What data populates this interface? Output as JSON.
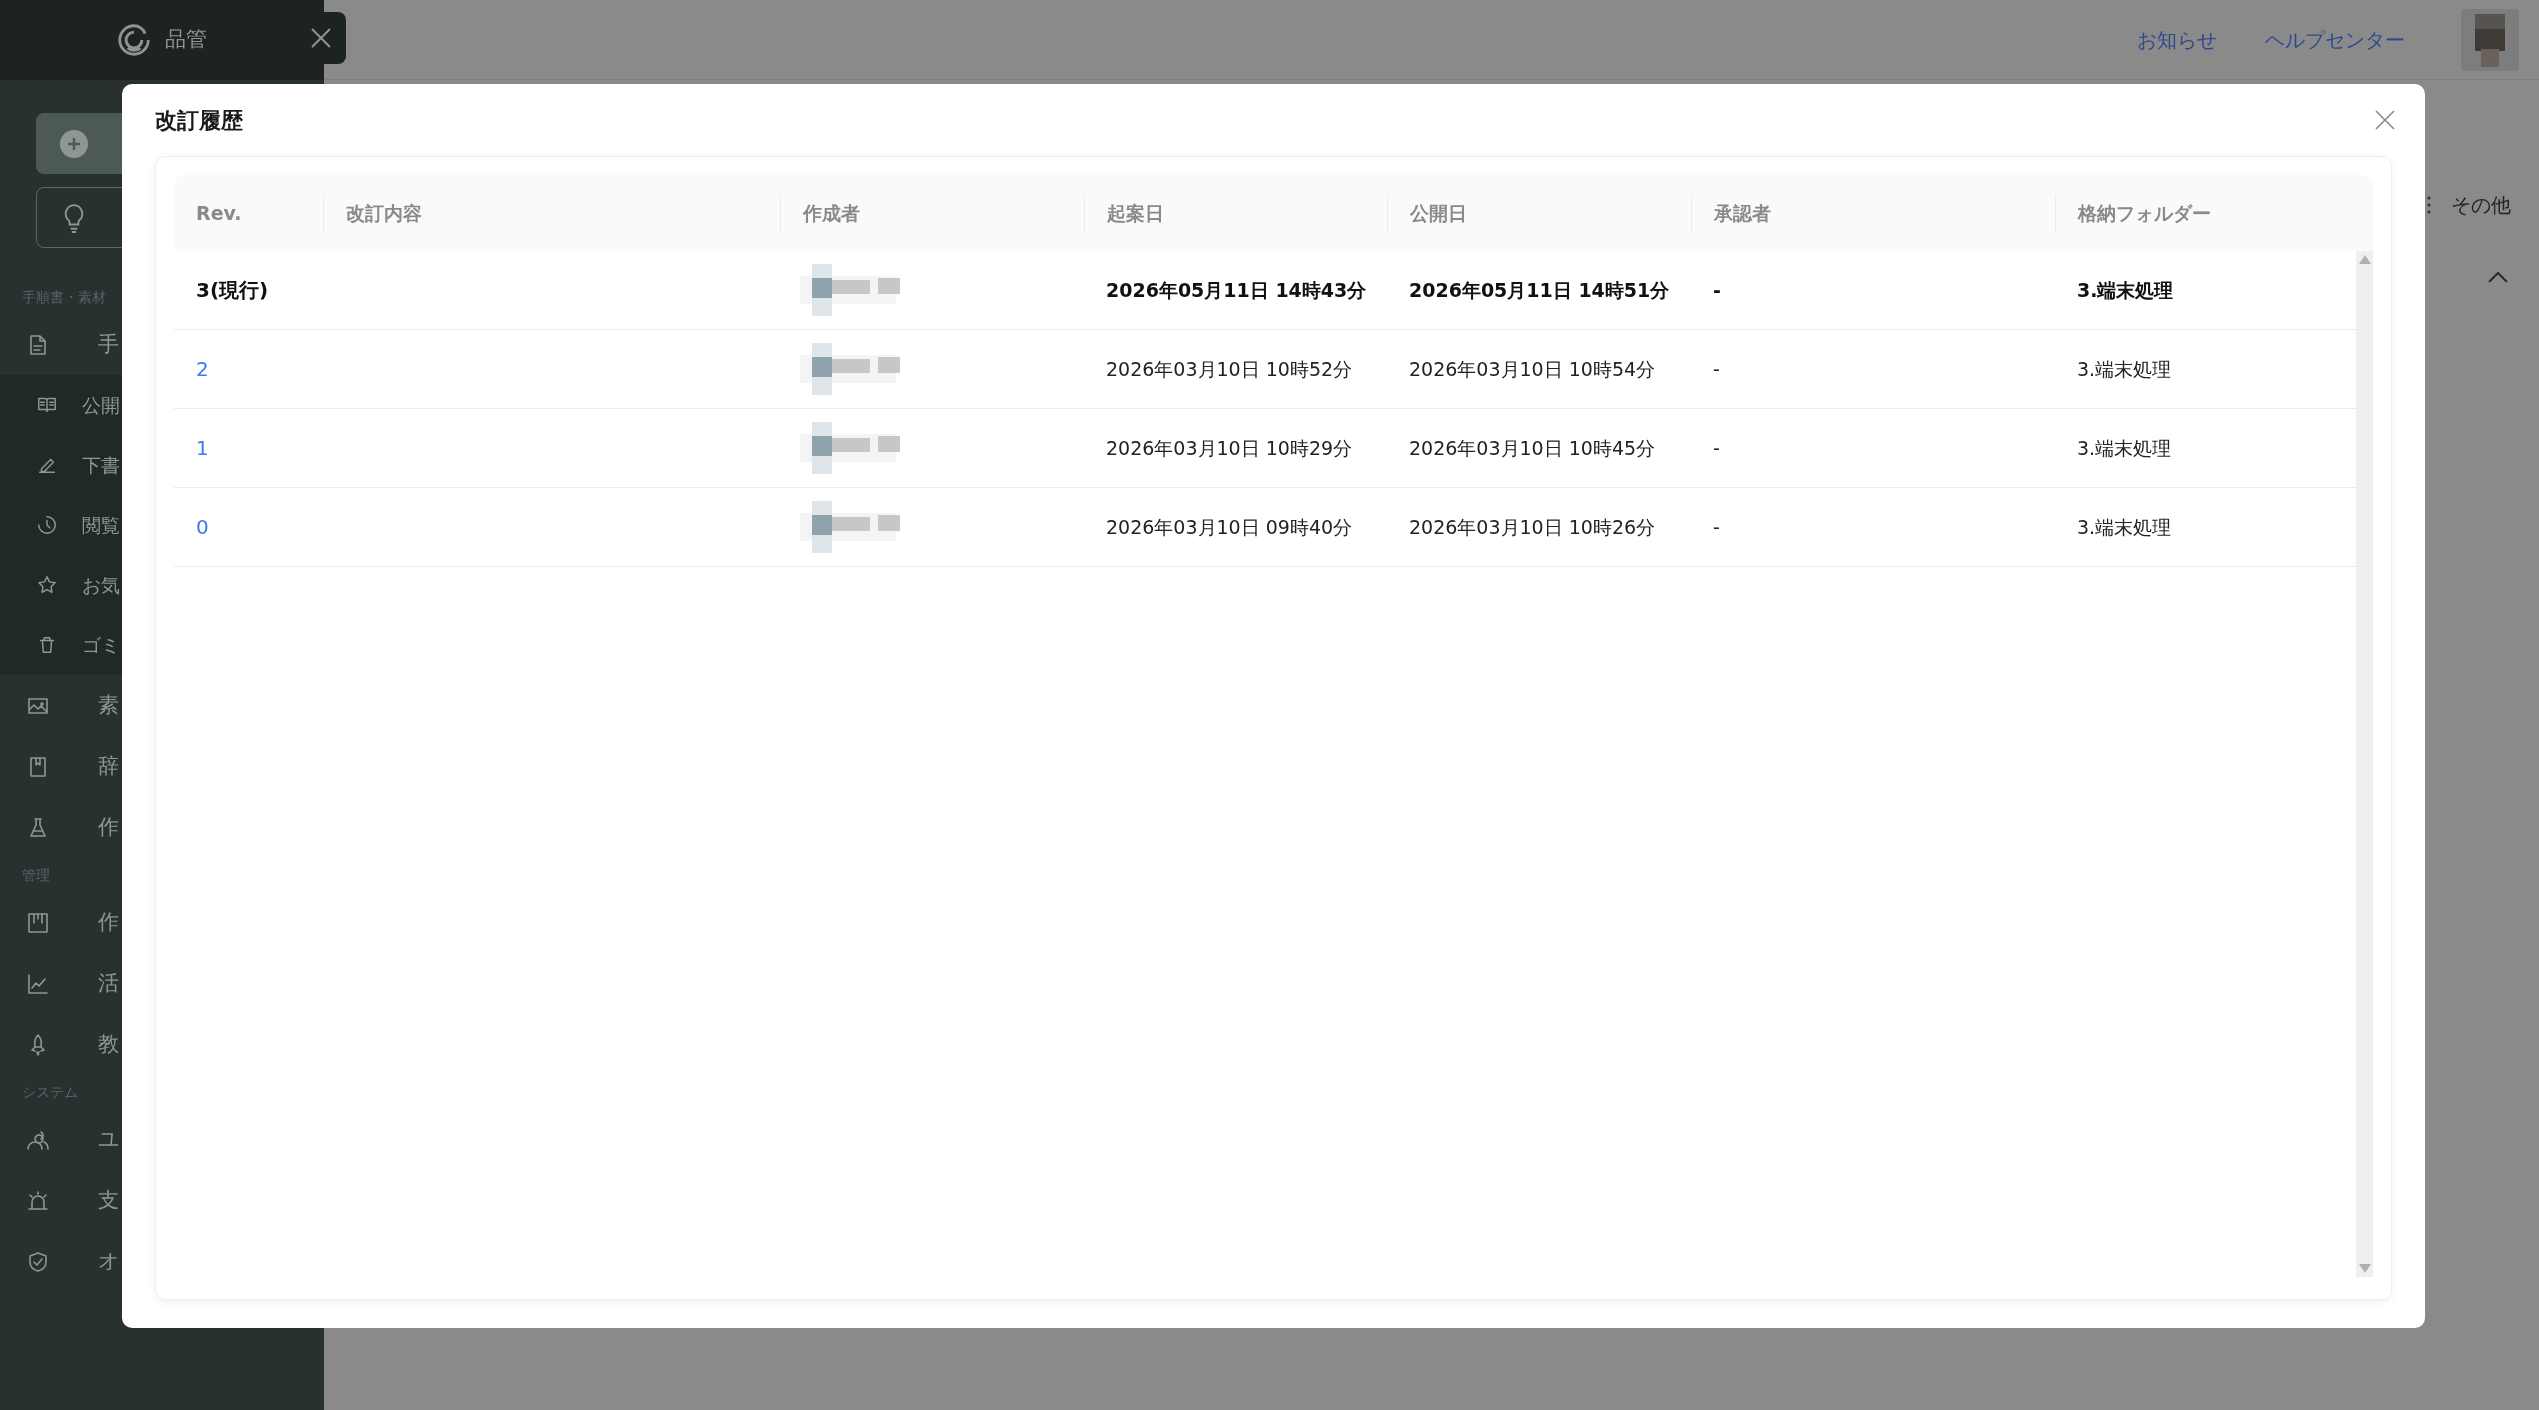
{
  "sidebar": {
    "brand": "品管",
    "sections": [
      {
        "heading": "手順書・素材",
        "items": [
          {
            "label": "手",
            "kind": "document",
            "children": [
              {
                "label": "公開",
                "kind": "book"
              },
              {
                "label": "下書",
                "kind": "pen"
              },
              {
                "label": "閲覧",
                "kind": "clock"
              },
              {
                "label": "お気",
                "kind": "star"
              },
              {
                "label": "ゴミ",
                "kind": "trash"
              }
            ]
          },
          {
            "label": "素",
            "kind": "image"
          },
          {
            "label": "辞",
            "kind": "bookmark"
          },
          {
            "label": "作",
            "kind": "flask"
          }
        ]
      },
      {
        "heading": "管理",
        "items": [
          {
            "label": "作",
            "kind": "board"
          },
          {
            "label": "活",
            "kind": "chart"
          },
          {
            "label": "教",
            "kind": "rocket"
          }
        ]
      },
      {
        "heading": "システム",
        "items": [
          {
            "label": "ユ",
            "kind": "users"
          },
          {
            "label": "支",
            "kind": "alarm"
          },
          {
            "label": "オ",
            "kind": "shield"
          }
        ]
      }
    ]
  },
  "header": {
    "links": [
      "お知らせ",
      "ヘルプセンター"
    ]
  },
  "background": {
    "more_button": "その他"
  },
  "modal": {
    "title": "改訂履歴",
    "columns": [
      "Rev.",
      "改訂内容",
      "作成者",
      "起案日",
      "公開日",
      "承認者",
      "格納フォルダー"
    ],
    "rows": [
      {
        "rev": "3(現行)",
        "current": true,
        "drafted": "2026年05月11日 14時43分",
        "published": "2026年05月11日 14時51分",
        "approver": "-",
        "folder": "3.端末処理"
      },
      {
        "rev": "2",
        "current": false,
        "drafted": "2026年03月10日 10時52分",
        "published": "2026年03月10日 10時54分",
        "approver": "-",
        "folder": "3.端末処理"
      },
      {
        "rev": "1",
        "current": false,
        "drafted": "2026年03月10日 10時29分",
        "published": "2026年03月10日 10時45分",
        "approver": "-",
        "folder": "3.端末処理"
      },
      {
        "rev": "0",
        "current": false,
        "drafted": "2026年03月10日 09時40分",
        "published": "2026年03月10日 10時26分",
        "approver": "-",
        "folder": "3.端末処理"
      }
    ]
  }
}
